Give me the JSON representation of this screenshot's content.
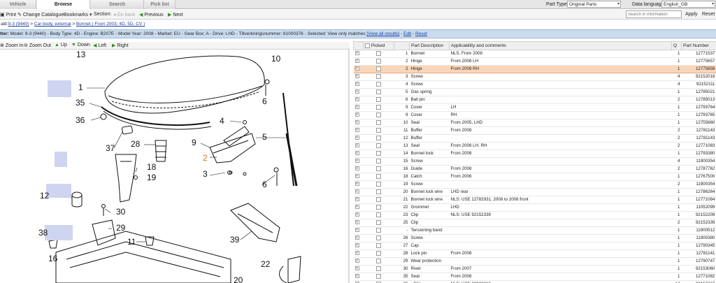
{
  "tabs": [
    "Vehicle",
    "Browse",
    "Search",
    "Pick list"
  ],
  "active_tab": "Browse",
  "part_type": {
    "label": "Part Type:",
    "value": "Original Parts"
  },
  "data_language": {
    "label": "Data language:",
    "value": "English_GB"
  },
  "search": {
    "placeholder": "Search in information",
    "apply": "Apply",
    "reset": "Reset"
  },
  "toolbar": {
    "print": "Print",
    "change_catalogue": "Change Catalogue",
    "bookmarks": "Bookmarks",
    "section": "Section:",
    "go_back": "Go back",
    "previous": "Previous",
    "next": "Next"
  },
  "breadcrumb": {
    "prefix": "ald:",
    "items": [
      "9-3 (9440)",
      "Car body, external",
      "Bonnet ( From 2003; 4D, 5D, CV )"
    ]
  },
  "filter": {
    "prefix": "tter:",
    "text": "Model: 9-3 (9440) - Body Type: 4D - Engine: B207E - Model Year: 2008 - Market: EU - Gear Box: A - Drive: LHD - Tillverkningsnummer: 81000376 - Selected: View only matches",
    "view_all": "[View all results]",
    "edit": "Edit",
    "reset": "Reset"
  },
  "image_toolbar": {
    "zoom_in": "Zoom In",
    "zoom_out": "Zoom Out",
    "up": "Up",
    "down": "Down",
    "left": "Left",
    "right": "Right"
  },
  "callouts": [
    {
      "n": "13"
    },
    {
      "n": "10"
    },
    {
      "n": "1"
    },
    {
      "n": "6"
    },
    {
      "n": "35"
    },
    {
      "n": "36"
    },
    {
      "n": "4"
    },
    {
      "n": "5"
    },
    {
      "n": "9"
    },
    {
      "n": "37"
    },
    {
      "n": "28"
    },
    {
      "n": "2",
      "orange": true
    },
    {
      "n": "18"
    },
    {
      "n": "3"
    },
    {
      "n": "19"
    },
    {
      "n": "6"
    },
    {
      "n": "12"
    },
    {
      "n": "30"
    },
    {
      "n": "29"
    },
    {
      "n": "38"
    },
    {
      "n": "11"
    },
    {
      "n": "39"
    },
    {
      "n": "16"
    },
    {
      "n": "22"
    },
    {
      "n": "20"
    }
  ],
  "table": {
    "headers": [
      "",
      "Picked",
      "",
      "Part Description",
      "Applicability and comments",
      "Q",
      "Part Number"
    ],
    "selected_row": 2,
    "rows": [
      [
        "1",
        "Bonnet",
        "NLS, From 2008",
        "1",
        "12771537"
      ],
      [
        "2",
        "Hinge",
        "From 2008 LH",
        "1",
        "12775657"
      ],
      [
        "2",
        "Hinge",
        "From 2008 RH",
        "1",
        "12775658"
      ],
      [
        "3",
        "Screw",
        "",
        "4",
        "92152018"
      ],
      [
        "4",
        "Screw",
        "",
        "4",
        "92152111"
      ],
      [
        "5",
        "Gas spring",
        "",
        "1",
        "12785021"
      ],
      [
        "6",
        "Ball pin",
        "",
        "2",
        "12785013"
      ],
      [
        "9",
        "Cover",
        "LH",
        "1",
        "12793764"
      ],
      [
        "9",
        "Cover",
        "RH",
        "1",
        "12793765"
      ],
      [
        "10",
        "Seal",
        "From 2005, LHD",
        "1",
        "12755660"
      ],
      [
        "11",
        "Buffer",
        "From 2008",
        "2",
        "12781143"
      ],
      [
        "12",
        "Buffer",
        "",
        "2",
        "12781143"
      ],
      [
        "13",
        "Seal",
        "From 2008 LH, RH",
        "2",
        "12771083"
      ],
      [
        "14",
        "Bonnet lock",
        "From 2008",
        "1",
        "12793380"
      ],
      [
        "15",
        "Screw",
        "",
        "4",
        "11900354"
      ],
      [
        "16",
        "Guide",
        "From 2008",
        "2",
        "12787762"
      ],
      [
        "18",
        "Catch",
        "From 2006",
        "1",
        "12767500"
      ],
      [
        "19",
        "Screw",
        "",
        "2",
        "11900354"
      ],
      [
        "20",
        "Bonnet lock wire",
        "LHD rear",
        "1",
        "12786264"
      ],
      [
        "21",
        "Bonnet lock wire",
        "NLS: USE 12782931, 2008 to 2008 front",
        "1",
        "12771084"
      ],
      [
        "22",
        "Grommet",
        "LHD",
        "1",
        "11052099"
      ],
      [
        "23",
        "Clip",
        "NLS: USE 92152339",
        "1",
        "92152209"
      ],
      [
        "25",
        "Clip",
        "",
        "2",
        "92152339"
      ],
      [
        "-",
        "Tensioning band",
        "",
        "1",
        "11900512"
      ],
      [
        "26",
        "Screw",
        "",
        "1",
        "11900380"
      ],
      [
        "27",
        "Cap",
        "",
        "1",
        "12790345"
      ],
      [
        "28",
        "Lock pin",
        "From 2008",
        "1",
        "12781141"
      ],
      [
        "29",
        "Wear protection",
        "",
        "1",
        "12790747"
      ],
      [
        "30",
        "Rivet",
        "From 2007",
        "1",
        "92153060"
      ],
      [
        "35",
        "Seal",
        "From 2008",
        "1",
        "12771082"
      ],
      [
        "36",
        "- Clip",
        "NLS: USE 32022210",
        "14",
        "92152219"
      ]
    ]
  }
}
